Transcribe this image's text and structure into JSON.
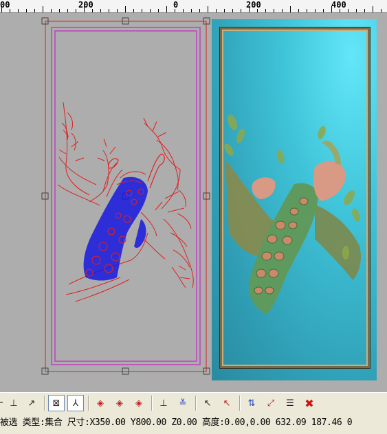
{
  "ruler": {
    "labels": [
      "00",
      "200",
      "0",
      "200",
      "400"
    ]
  },
  "status": {
    "text": "被选 类型:集合 尺寸:X350.00 Y800.00 Z0.00 高度:0.00,0.00 632.09 187.46 0"
  },
  "toolbar": {
    "buttons": [
      {
        "name": "view-tool-partial-button",
        "glyph": "⌐"
      },
      {
        "name": "axis-tool-button",
        "glyph": "⊥"
      },
      {
        "name": "curve-tool-button",
        "glyph": "↗"
      },
      {
        "name": "node-snap-button",
        "glyph": "⊠"
      },
      {
        "name": "select-mode-button",
        "glyph": "⅄"
      },
      {
        "name": "diamond-tool-1-button",
        "glyph": "◈"
      },
      {
        "name": "diamond-tool-2-button",
        "glyph": "◈"
      },
      {
        "name": "diamond-tool-3-button",
        "glyph": "◈"
      },
      {
        "name": "layer-tool-1-button",
        "glyph": "⊥"
      },
      {
        "name": "layer-tool-2-button",
        "glyph": "≚"
      },
      {
        "name": "pick-cursor-1-button",
        "glyph": "↖"
      },
      {
        "name": "pick-cursor-2-button",
        "glyph": "↖"
      },
      {
        "name": "transform-tool-1-button",
        "glyph": "⇅"
      },
      {
        "name": "transform-tool-2-button",
        "glyph": "⤢"
      },
      {
        "name": "list-tool-button",
        "glyph": "☰"
      },
      {
        "name": "delete-button",
        "glyph": "✖"
      }
    ]
  },
  "colors": {
    "canvas_bg": "#adadad",
    "selection_red": "#e02020",
    "boundary_magenta": "#c040c0",
    "vector_blue": "#1818e0",
    "relief_cyan": "#3fc3d8"
  }
}
